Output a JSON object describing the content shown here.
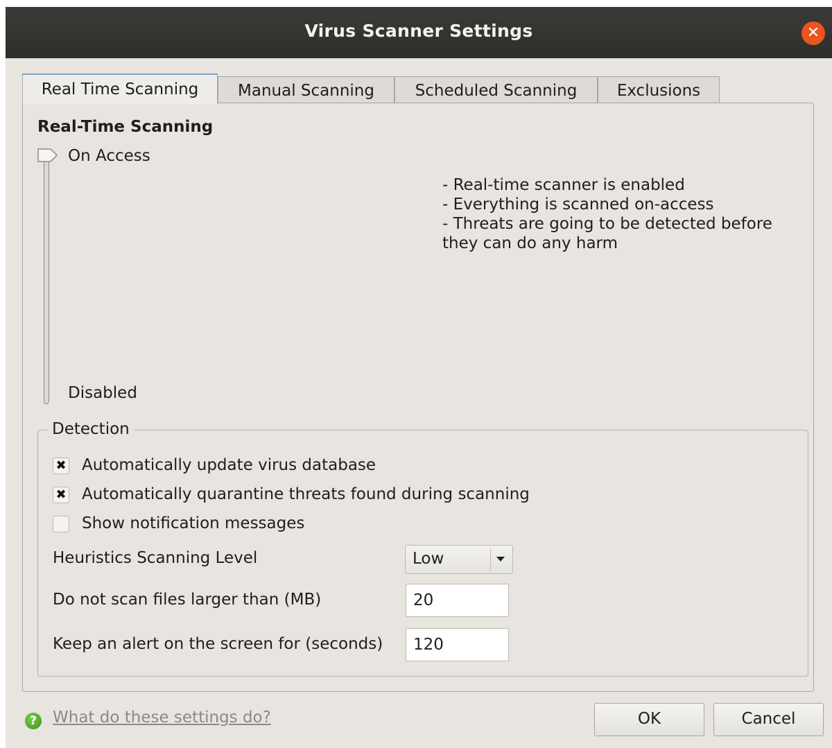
{
  "window": {
    "title": "Virus Scanner Settings",
    "close_icon": "close-icon"
  },
  "tabs": [
    {
      "label": "Real Time Scanning",
      "active": true
    },
    {
      "label": "Manual Scanning",
      "active": false
    },
    {
      "label": "Scheduled Scanning",
      "active": false
    },
    {
      "label": "Exclusions",
      "active": false
    }
  ],
  "realtime": {
    "heading": "Real-Time Scanning",
    "level_top": "On Access",
    "level_bottom": "Disabled",
    "selected_level": "On Access",
    "description": [
      "- Real-time scanner is enabled",
      "- Everything is scanned on-access",
      "- Threats are going to be detected before",
      "they can do any harm"
    ]
  },
  "detection": {
    "legend": "Detection",
    "checkboxes": [
      {
        "label": "Automatically update virus database",
        "checked": true
      },
      {
        "label": "Automatically quarantine threats found during scanning",
        "checked": true
      },
      {
        "label": "Show notification messages",
        "checked": false
      }
    ],
    "heuristics_label": "Heuristics Scanning Level",
    "heuristics_value": "Low",
    "max_size_label": "Do not scan files larger than (MB)",
    "max_size_value": "20",
    "alert_label": "Keep an alert on the screen for (seconds)",
    "alert_value": "120"
  },
  "footer": {
    "help_icon": "help-icon",
    "help_link": "What do these settings do?",
    "ok_label": "OK",
    "cancel_label": "Cancel"
  },
  "colors": {
    "titlebar": "#2e2e2b",
    "close_button": "#e9541f",
    "window_bg": "#e8e5e1",
    "link": "#8a8a8a"
  }
}
